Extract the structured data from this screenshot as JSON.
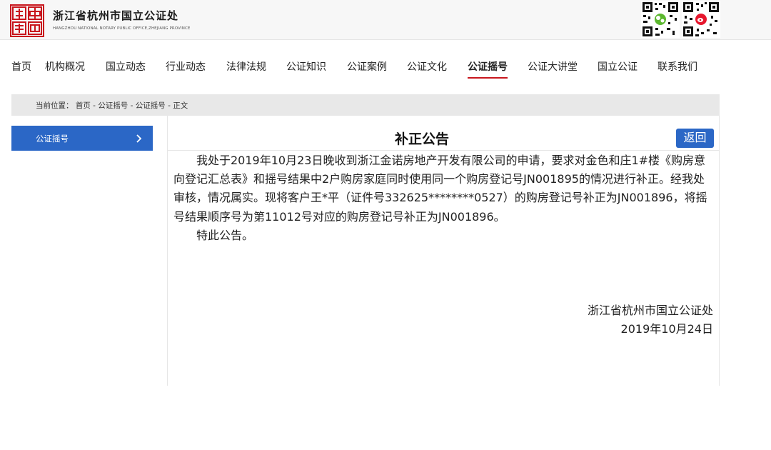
{
  "header": {
    "site_name_cn": "浙江省杭州市国立公证处",
    "site_name_en": "HANGZHOU NATIONAL NOTARY PUBLIC OFFICE,ZHEJIANG PROVINCE",
    "logo_icon": "seal-logo-icon",
    "qr_icons": [
      "wechat-qr-icon",
      "weibo-qr-icon"
    ]
  },
  "nav": {
    "items": [
      {
        "label": "首页"
      },
      {
        "label": "机构概况"
      },
      {
        "label": "国立动态"
      },
      {
        "label": "行业动态"
      },
      {
        "label": "法律法规"
      },
      {
        "label": "公证知识"
      },
      {
        "label": "公证案例"
      },
      {
        "label": "公证文化"
      },
      {
        "label": "公证摇号"
      },
      {
        "label": "公证大讲堂"
      },
      {
        "label": "国立公证"
      },
      {
        "label": "联系我们"
      }
    ],
    "active": "公证摇号"
  },
  "breadcrumb": {
    "text": "当前位置： 首页 - 公证摇号 - 公证摇号 - 正文"
  },
  "sidebar": {
    "items": [
      {
        "label": "公证摇号",
        "icon": "chevron-right-icon"
      }
    ]
  },
  "article": {
    "title": "补正公告",
    "back_label": "返回",
    "paragraph1": "我处于2019年10月23日晚收到浙江金诺房地产开发有限公司的申请，要求对金色和庄1#楼《购房意向登记汇总表》和摇号结果中2户购房家庭同时使用同一个购房登记号JN001895的情况进行补正。经我处审核，情况属实。现将客户王*平（证件号332625********0527）的购房登记号补正为JN001896，将摇号结果顺序号为第11012号对应的购房登记号补正为JN001896。",
    "paragraph2": "特此公告。",
    "signature_org": "浙江省杭州市国立公证处",
    "signature_date": "2019年10月24日"
  },
  "colors": {
    "accent_blue": "#2b67c6",
    "brand_red": "#c8161d",
    "header_bg": "#f7f7f7",
    "crumb_bg": "#e8e8e8"
  }
}
